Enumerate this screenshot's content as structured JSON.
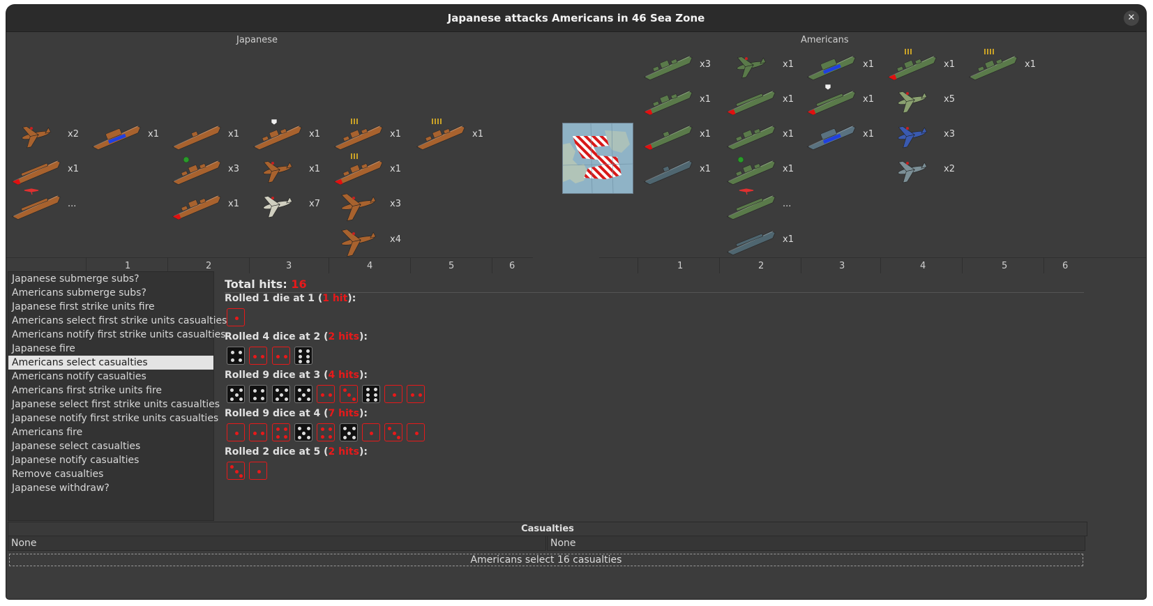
{
  "window": {
    "title": "Japanese attacks Americans in 46 Sea Zone",
    "close_label": "✕"
  },
  "sides": {
    "attacker": "Japanese",
    "defender": "Americans"
  },
  "attacker_units": [
    {
      "unit": "carrier-with-fighter",
      "count": "x2",
      "color": "#a8622e",
      "accent": "none"
    },
    {
      "unit": "transport",
      "count": "x1",
      "color": "#a8622e",
      "accent": "#2040e0"
    },
    {
      "unit": "damaged-carrier",
      "count": "x1",
      "color": "#a8622e",
      "accent": "#e01010"
    },
    {
      "unit": "carrier-with-bomber",
      "count": "...",
      "color": "#a8622e",
      "accent": "none"
    },
    {
      "unit": "submarine",
      "count": "x1",
      "color": "#a8622e",
      "accent": "none"
    },
    {
      "unit": "destroyer-aa",
      "count": "x3",
      "color": "#a8622e",
      "accent": "none"
    },
    {
      "unit": "damaged-destroyer",
      "count": "x1",
      "color": "#a8622e",
      "accent": "#e01010"
    },
    {
      "unit": "cruiser-shield",
      "count": "x1",
      "color": "#a8622e",
      "accent": "none"
    },
    {
      "unit": "fighter",
      "count": "x1",
      "color": "#a8622e",
      "accent": "none"
    },
    {
      "unit": "fighter-light",
      "count": "x7",
      "color": "#d0cfc0",
      "accent": "none"
    },
    {
      "unit": "battleship-3",
      "count": "x1",
      "color": "#a8622e",
      "accent": "none"
    },
    {
      "unit": "damaged-battleship-3",
      "count": "x1",
      "color": "#a8622e",
      "accent": "#e01010"
    },
    {
      "unit": "tactical-bomber",
      "count": "x3",
      "color": "#a8622e",
      "accent": "none"
    },
    {
      "unit": "bomber",
      "count": "x4",
      "color": "#a8622e",
      "accent": "none"
    },
    {
      "unit": "battleship-4",
      "count": "x1",
      "color": "#a8622e",
      "accent": "none"
    }
  ],
  "defender_units": [
    {
      "unit": "cruiser",
      "count": "x3",
      "color": "#5a7a4a",
      "accent": "none"
    },
    {
      "unit": "carrier-with-fighter",
      "count": "x1",
      "color": "#5a7a4a",
      "accent": "none"
    },
    {
      "unit": "transport",
      "count": "x1",
      "color": "#5a7a4a",
      "accent": "#2040e0"
    },
    {
      "unit": "damaged-battleship-3",
      "count": "x1",
      "color": "#5a7a4a",
      "accent": "#e01010"
    },
    {
      "unit": "battleship-4",
      "count": "x1",
      "color": "#5a7a4a",
      "accent": "none"
    },
    {
      "unit": "damaged-cruiser",
      "count": "x1",
      "color": "#5a7a4a",
      "accent": "#e01010"
    },
    {
      "unit": "damaged-carrier",
      "count": "x1",
      "color": "#5a7a4a",
      "accent": "#e01010"
    },
    {
      "unit": "damaged-carrier-shield",
      "count": "x1",
      "color": "#5a7a4a",
      "accent": "#e01010"
    },
    {
      "unit": "fighter",
      "count": "x5",
      "color": "#8aa070",
      "accent": "none"
    },
    {
      "unit": "damaged-submarine",
      "count": "x1",
      "color": "#5a7a4a",
      "accent": "#e01010"
    },
    {
      "unit": "destroyer",
      "count": "x1",
      "color": "#5a7a4a",
      "accent": "none"
    },
    {
      "unit": "transport-grey",
      "count": "x1",
      "color": "#5a7280",
      "accent": "#2040e0"
    },
    {
      "unit": "fighter-blue",
      "count": "x3",
      "color": "#3a5ab0",
      "accent": "none"
    },
    {
      "unit": "submarine-grey",
      "count": "x1",
      "color": "#4f6670",
      "accent": "none"
    },
    {
      "unit": "destroyer-aa",
      "count": "x1",
      "color": "#5a7a4a",
      "accent": "none"
    },
    {
      "unit": "fighter-grey",
      "count": "x2",
      "color": "#7c8f96",
      "accent": "none"
    },
    {
      "unit": "carrier-with-bomber",
      "count": "...",
      "color": "#5a7a4a",
      "accent": "none"
    },
    {
      "unit": "carrier-grey",
      "count": "x1",
      "color": "#4f6670",
      "accent": "none"
    }
  ],
  "axis_left": [
    "1",
    "2",
    "3",
    "4",
    "5",
    "6"
  ],
  "axis_right": [
    "1",
    "2",
    "3",
    "4",
    "5",
    "6"
  ],
  "steps": [
    {
      "label": "Japanese submerge subs?",
      "selected": false
    },
    {
      "label": "Americans submerge subs?",
      "selected": false
    },
    {
      "label": "Japanese first strike units fire",
      "selected": false
    },
    {
      "label": "Americans select first strike units casualties",
      "selected": false
    },
    {
      "label": "Americans notify first strike units casualties",
      "selected": false
    },
    {
      "label": "Japanese fire",
      "selected": false
    },
    {
      "label": "Americans select casualties",
      "selected": true
    },
    {
      "label": "Americans notify casualties",
      "selected": false
    },
    {
      "label": "Americans first strike units fire",
      "selected": false
    },
    {
      "label": "Japanese select first strike units casualties",
      "selected": false
    },
    {
      "label": "Japanese notify first strike units casualties",
      "selected": false
    },
    {
      "label": "Americans fire",
      "selected": false
    },
    {
      "label": "Japanese select casualties",
      "selected": false
    },
    {
      "label": "Japanese notify casualties",
      "selected": false
    },
    {
      "label": "Remove casualties",
      "selected": false
    },
    {
      "label": "Japanese withdraw?",
      "selected": false
    }
  ],
  "total_hits": {
    "label": "Total hits:",
    "value": "16"
  },
  "rolls": [
    {
      "prefix": "Rolled 1 die at 1 (",
      "hits": "1 hit",
      "suffix": "):",
      "dice": [
        [
          1,
          true
        ]
      ]
    },
    {
      "prefix": "Rolled 4 dice at 2 (",
      "hits": "2 hits",
      "suffix": "):",
      "dice": [
        [
          4,
          false
        ],
        [
          2,
          true
        ],
        [
          2,
          true
        ],
        [
          6,
          false
        ]
      ]
    },
    {
      "prefix": "Rolled 9 dice at 3 (",
      "hits": "4 hits",
      "suffix": "):",
      "dice": [
        [
          5,
          false
        ],
        [
          4,
          false
        ],
        [
          5,
          false
        ],
        [
          5,
          false
        ],
        [
          2,
          true
        ],
        [
          3,
          true
        ],
        [
          6,
          false
        ],
        [
          1,
          true
        ],
        [
          2,
          true
        ]
      ]
    },
    {
      "prefix": "Rolled 9 dice at 4 (",
      "hits": "7 hits",
      "suffix": "):",
      "dice": [
        [
          1,
          true
        ],
        [
          2,
          true
        ],
        [
          4,
          true
        ],
        [
          5,
          false
        ],
        [
          4,
          true
        ],
        [
          5,
          false
        ],
        [
          1,
          true
        ],
        [
          3,
          true
        ],
        [
          1,
          true
        ]
      ]
    },
    {
      "prefix": "Rolled 2 dice at 5 (",
      "hits": "2 hits",
      "suffix": "):",
      "dice": [
        [
          3,
          true
        ],
        [
          1,
          true
        ]
      ]
    }
  ],
  "casualties": {
    "header": "Casualties",
    "left": "None",
    "right": "None"
  },
  "status": "Americans select 16 casualties"
}
